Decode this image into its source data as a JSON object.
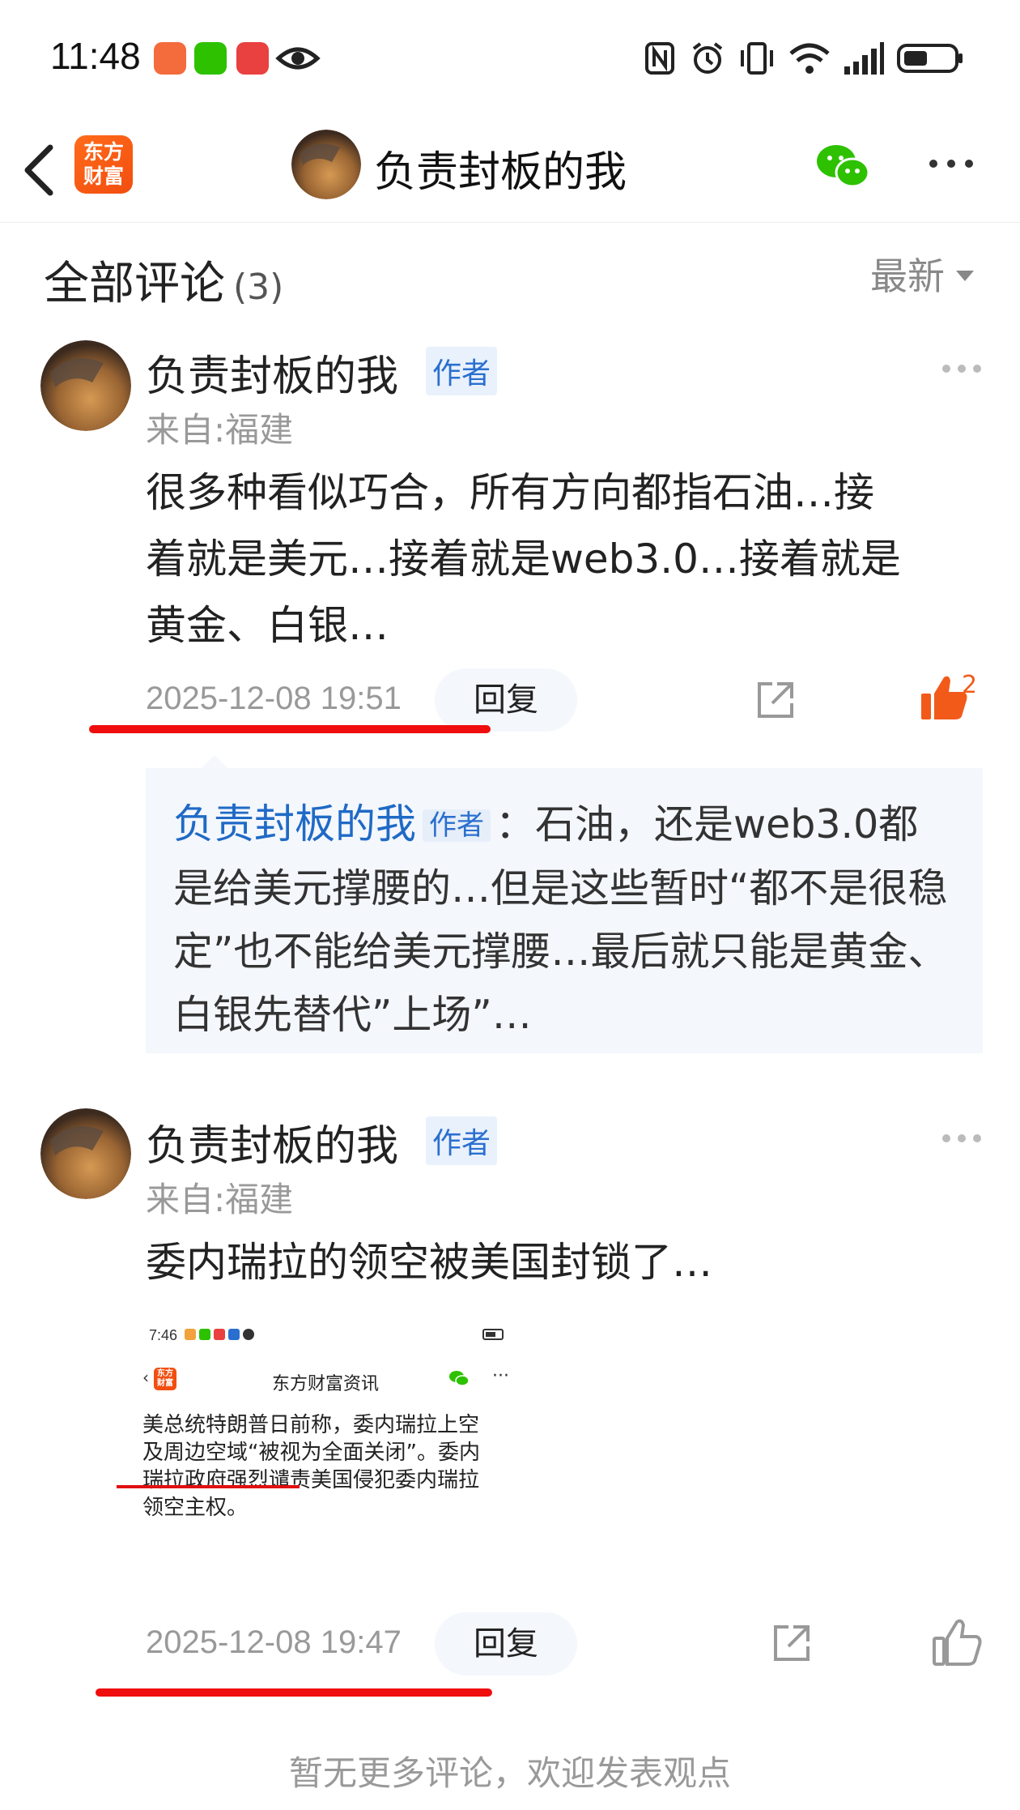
{
  "status_bar": {
    "time": "11:48"
  },
  "header": {
    "app_logo_text": "东方财富",
    "title": "负责封板的我"
  },
  "comments_section": {
    "title": "全部评论",
    "count": "(3)",
    "sort_label": "最新"
  },
  "comments": [
    {
      "author": "负责封板的我",
      "badge": "作者",
      "location": "来自:福建",
      "content_lines": [
        "很多种看似巧合，所有方向都指石油…接",
        "着就是美元…接着就是web3.0…接着就是",
        "黄金、白银…"
      ],
      "timestamp": "2025-12-08 19:51",
      "reply_label": "回复",
      "like_count": "2",
      "reply": {
        "author": "负责封板的我",
        "badge": "作者",
        "text": "：石油，还是web3.0都是给美元撑腰的…但是这些暂时“都不是很稳定”也不能给美元撑腰…最后就只能是黄金、白银先替代”上场”…"
      }
    },
    {
      "author": "负责封板的我",
      "badge": "作者",
      "location": "来自:福建",
      "content": "委内瑞拉的领空被美国封锁了…",
      "timestamp": "2025-12-08 19:47",
      "reply_label": "回复",
      "embedded_image": {
        "status_time": "7:46",
        "logo_text": "东方财富",
        "title": "东方财富资讯",
        "body_lines": [
          "美总统特朗普日前称，委内瑞拉上空",
          "及周边空域“被视为全面关闭”。委内",
          "瑞拉政府强烈谴责美国侵犯委内瑞拉",
          "领空主权。"
        ]
      }
    }
  ],
  "footer": {
    "text": "暂无更多评论，欢迎发表观点"
  },
  "colors": {
    "accent_orange": "#f25a1a",
    "link_blue": "#1f6ac6",
    "annotation_red": "#ef0d0d",
    "wechat_green": "#2dc100"
  }
}
